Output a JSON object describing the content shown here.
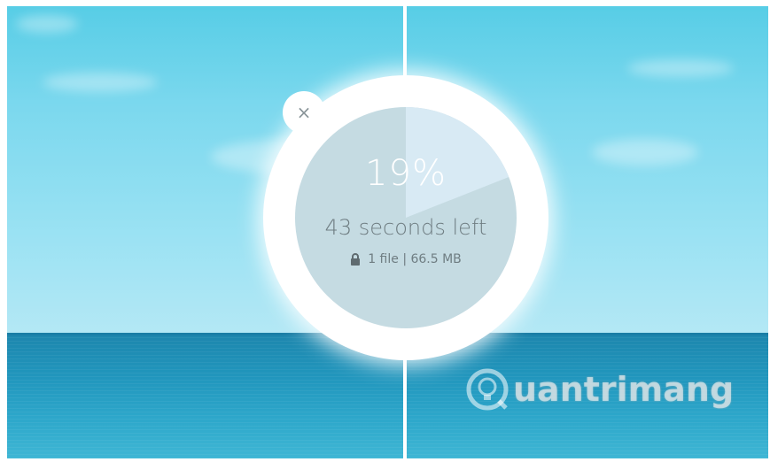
{
  "transfer": {
    "percent_label": "19%",
    "progress": 0.19,
    "time_left": "43 seconds left",
    "files_label": "1 file | 66.5 MB"
  },
  "controls": {
    "close_label": "×"
  },
  "watermark": {
    "text": "uantrimang"
  },
  "colors": {
    "dial_bg": "#c5dbe2",
    "progress_fill": "#d8eaf4",
    "ring": "#ffffff",
    "text_muted": "#6f7d82"
  }
}
